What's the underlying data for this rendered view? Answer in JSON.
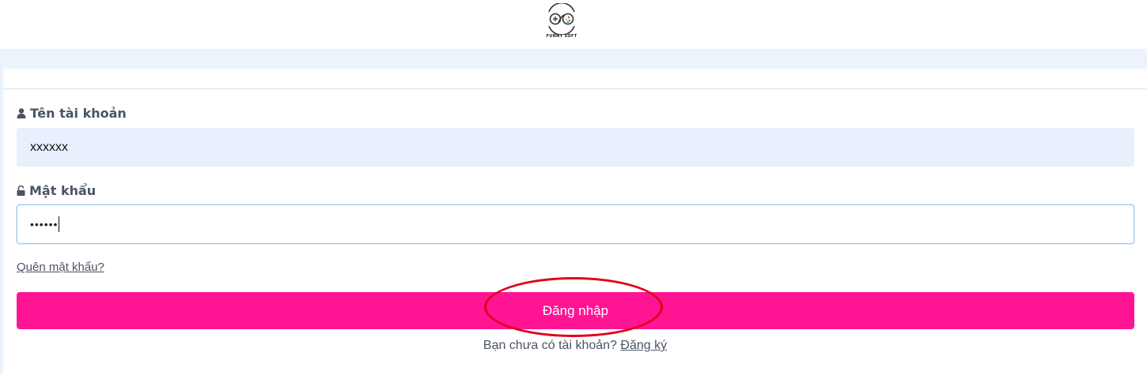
{
  "header": {
    "logo_name": "gamepad-logo-icon",
    "logo_text": "FUNNY SOFT"
  },
  "form": {
    "username_label": "Tên tài khoản",
    "username_value": "xxxxxx",
    "password_label": "Mật khẩu",
    "password_masked": "••••••",
    "forgot_link": "Quên mật khẩu?",
    "login_button": "Đăng nhập",
    "signup_prompt": "Bạn chưa có tài khoản?",
    "signup_link": "Đăng ký"
  },
  "colors": {
    "accent": "#ff1493",
    "highlight": "#e3001b",
    "input_bg": "#e8f0fe",
    "focus_border": "#9ec5f0"
  },
  "icons": {
    "username": "user-icon",
    "password": "unlock-icon"
  }
}
